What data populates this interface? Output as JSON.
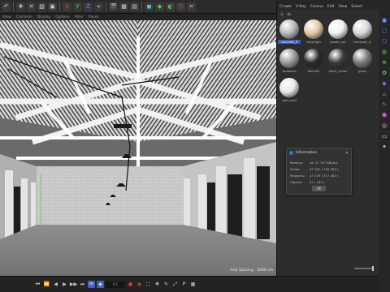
{
  "toolbar": {
    "items": [
      "↶",
      "✥",
      "✕",
      "▧",
      "▣",
      "X",
      "Y",
      "Z",
      "⌖",
      "🎬",
      "▦",
      "▤",
      "◼",
      "◆",
      "◐",
      "⬡",
      "⌗"
    ]
  },
  "viewport": {
    "menu": [
      "View",
      "Cameras",
      "Display",
      "Options",
      "Filter",
      "Panel"
    ],
    "grid_spacing": "Grid Spacing : 5000 cm"
  },
  "material_manager": {
    "menu": [
      "Create",
      "V-Ray",
      "Corona",
      "Edit",
      "View",
      "Select"
    ],
    "materials": [
      {
        "label": "concrete_fl",
        "color": "#b8b8b8",
        "selected": true
      },
      {
        "label": "lampligth",
        "color": "#e0c8a8",
        "selected": false
      },
      {
        "label": "plastic_wo",
        "color": "#f0f0f0",
        "selected": false
      },
      {
        "label": "brickwall_b",
        "color": "#d8d8d8",
        "selected": false
      },
      {
        "label": "radiators",
        "color": "#9a9a9a",
        "selected": false
      },
      {
        "label": "blackPS",
        "color": "#2a2a2a",
        "selected": false
      },
      {
        "label": "black_metal",
        "color": "#3a3a3a",
        "selected": false
      },
      {
        "label": "glass",
        "color": "#7a7a7a",
        "selected": false
      },
      {
        "label": "wall_pas2",
        "color": "#e8e8e8",
        "selected": false
      }
    ]
  },
  "info_dialog": {
    "title": "Information",
    "rows": [
      {
        "key": "Memory:",
        "value": "ca. 21 747 KBytes"
      },
      {
        "key": "Points:",
        "value": "45 361 ( 236 280 )"
      },
      {
        "key": "Polygons:",
        "value": "47 039 ( 317 463 )"
      },
      {
        "key": "Objects:",
        "value": "47 ( 244 )"
      }
    ],
    "ok_label": "OK"
  },
  "timeline": {
    "current_frame": "0 F",
    "buttons": [
      "⏮",
      "⏪",
      "◀",
      "▶",
      "▶▶",
      "⏭"
    ]
  },
  "colors": {
    "accent": "#3c5fbd",
    "record": "#e03a3a"
  }
}
